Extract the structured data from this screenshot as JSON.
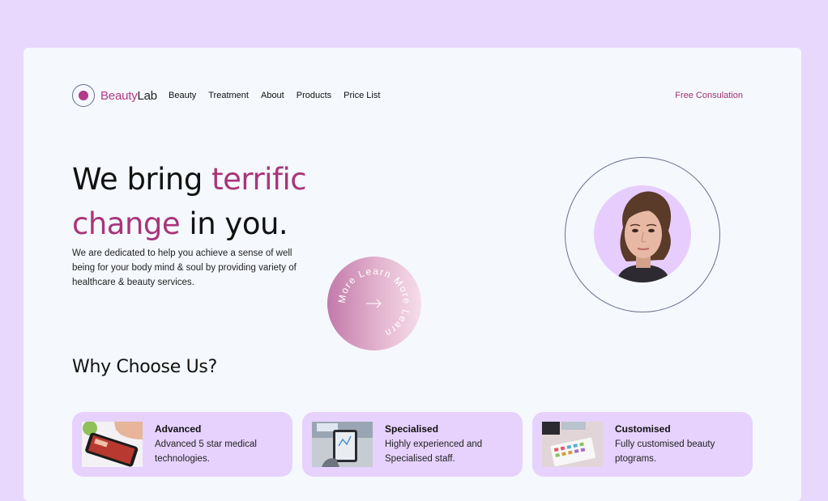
{
  "brand": {
    "name_part1": "Beauty",
    "name_part2": "Lab"
  },
  "nav": {
    "items": [
      {
        "label": "Beauty"
      },
      {
        "label": "Treatment"
      },
      {
        "label": "About"
      },
      {
        "label": "Products"
      },
      {
        "label": "Price List"
      }
    ],
    "cta": "Free Consulation"
  },
  "hero": {
    "title_line1_plain": "We bring ",
    "title_line1_accent": "terrific",
    "title_line2_accent": "change",
    "title_line2_plain": " in you.",
    "description": "We are dedicated to help you achieve a sense of well being for your body mind & soul by providing variety of healthcare & beauty services.",
    "badge_text": "More Learn More Learn"
  },
  "why": {
    "title": "Why Choose Us?",
    "features": [
      {
        "title": "Advanced",
        "desc": "Advanced 5 star medical technologies."
      },
      {
        "title": "Specialised",
        "desc": "Highly experienced and Specialised staff."
      },
      {
        "title": "Customised",
        "desc": "Fully customised beauty ptograms."
      }
    ]
  },
  "colors": {
    "accent": "#a8357a",
    "background": "#e8d8fd",
    "card": "#f5f8fd",
    "feature_bg": "#e6d2fd"
  }
}
